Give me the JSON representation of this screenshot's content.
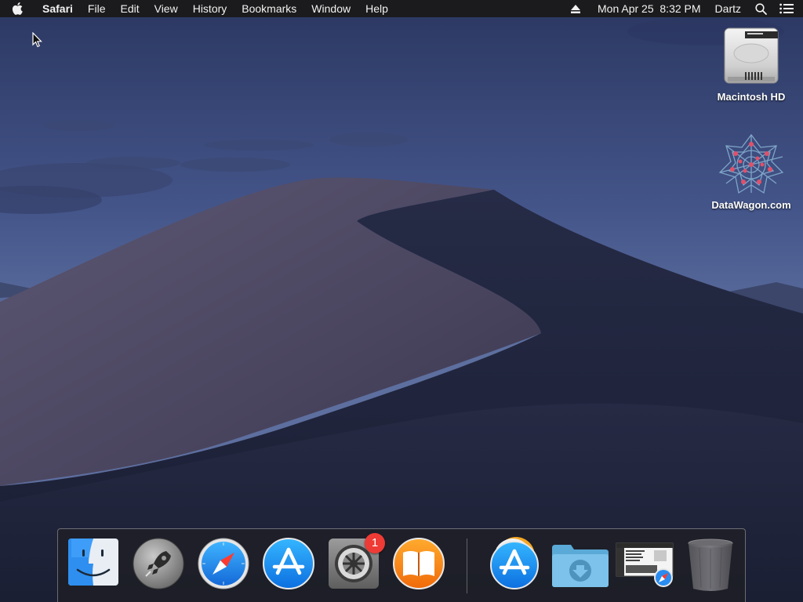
{
  "menubar": {
    "app_name": "Safari",
    "items": [
      "File",
      "Edit",
      "View",
      "History",
      "Bookmarks",
      "Window",
      "Help"
    ],
    "datetime": "Mon Apr 25  8:32 PM",
    "user": "Dartz"
  },
  "desktop": {
    "icons": [
      {
        "label": "Macintosh HD",
        "icon": "hard-drive-icon"
      },
      {
        "label": "DataWagon.com",
        "icon": "network-volume-icon"
      }
    ]
  },
  "dock": {
    "apps": [
      {
        "name": "Finder",
        "icon": "finder-icon",
        "running": true
      },
      {
        "name": "Launchpad",
        "icon": "launchpad-icon",
        "running": false
      },
      {
        "name": "Safari",
        "icon": "safari-icon",
        "running": true
      },
      {
        "name": "App Store",
        "icon": "app-store-icon",
        "running": false
      },
      {
        "name": "System Preferences",
        "icon": "system-preferences-icon",
        "running": false,
        "badge": "1"
      },
      {
        "name": "iBooks",
        "icon": "books-icon",
        "running": false
      }
    ],
    "others": [
      {
        "name": "Applications",
        "icon": "applications-stack-icon"
      },
      {
        "name": "Downloads",
        "icon": "downloads-folder-icon"
      },
      {
        "name": "Safari window",
        "icon": "minimized-window-icon"
      },
      {
        "name": "Trash",
        "icon": "trash-icon"
      }
    ]
  },
  "colors": {
    "menubar_bg": "#1b1b1d",
    "badge": "#ee3b35",
    "sky_top": "#2d3a66",
    "sky_horizon": "#6a7ba8"
  }
}
